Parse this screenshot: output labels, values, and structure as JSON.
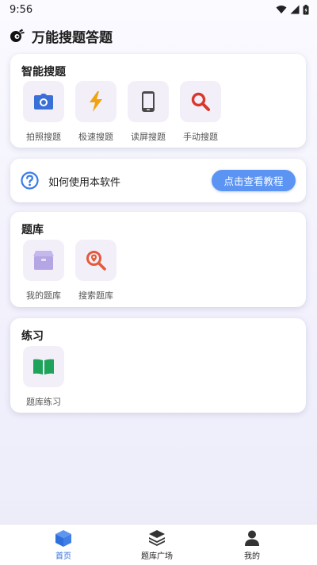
{
  "status_bar": {
    "time": "9:56",
    "icons": [
      "wifi-icon",
      "signal-icon",
      "battery-icon"
    ]
  },
  "app": {
    "title": "万能搜题答题",
    "logo_icon": "logo-icon"
  },
  "smart_search": {
    "title": "智能搜题",
    "items": [
      {
        "label": "拍照搜题",
        "icon": "camera-icon",
        "color": "#3a6fd8"
      },
      {
        "label": "极速搜题",
        "icon": "lightning-icon",
        "color": "#f2a20f"
      },
      {
        "label": "读屏搜题",
        "icon": "phone-icon",
        "color": "#4a4a4a"
      },
      {
        "label": "手动搜题",
        "icon": "search-icon",
        "color": "#d9372c"
      }
    ]
  },
  "help": {
    "text": "如何使用本软件",
    "button": "点击查看教程",
    "icon": "help-icon",
    "accent": "#5b94f2"
  },
  "question_bank": {
    "title": "题库",
    "items": [
      {
        "label": "我的题库",
        "icon": "box-icon",
        "color": "#b4a6e4"
      },
      {
        "label": "搜索题库",
        "icon": "search-location-icon",
        "color": "#e45a3c"
      }
    ]
  },
  "practice": {
    "title": "练习",
    "items": [
      {
        "label": "题库练习",
        "icon": "book-icon",
        "color": "#1ea35a"
      }
    ]
  },
  "bottom_nav": {
    "items": [
      {
        "label": "首页",
        "icon": "cube-icon",
        "active": true
      },
      {
        "label": "题库广场",
        "icon": "layers-icon",
        "active": false
      },
      {
        "label": "我的",
        "icon": "user-icon",
        "active": false
      }
    ],
    "active_color": "#2f6fdc"
  }
}
